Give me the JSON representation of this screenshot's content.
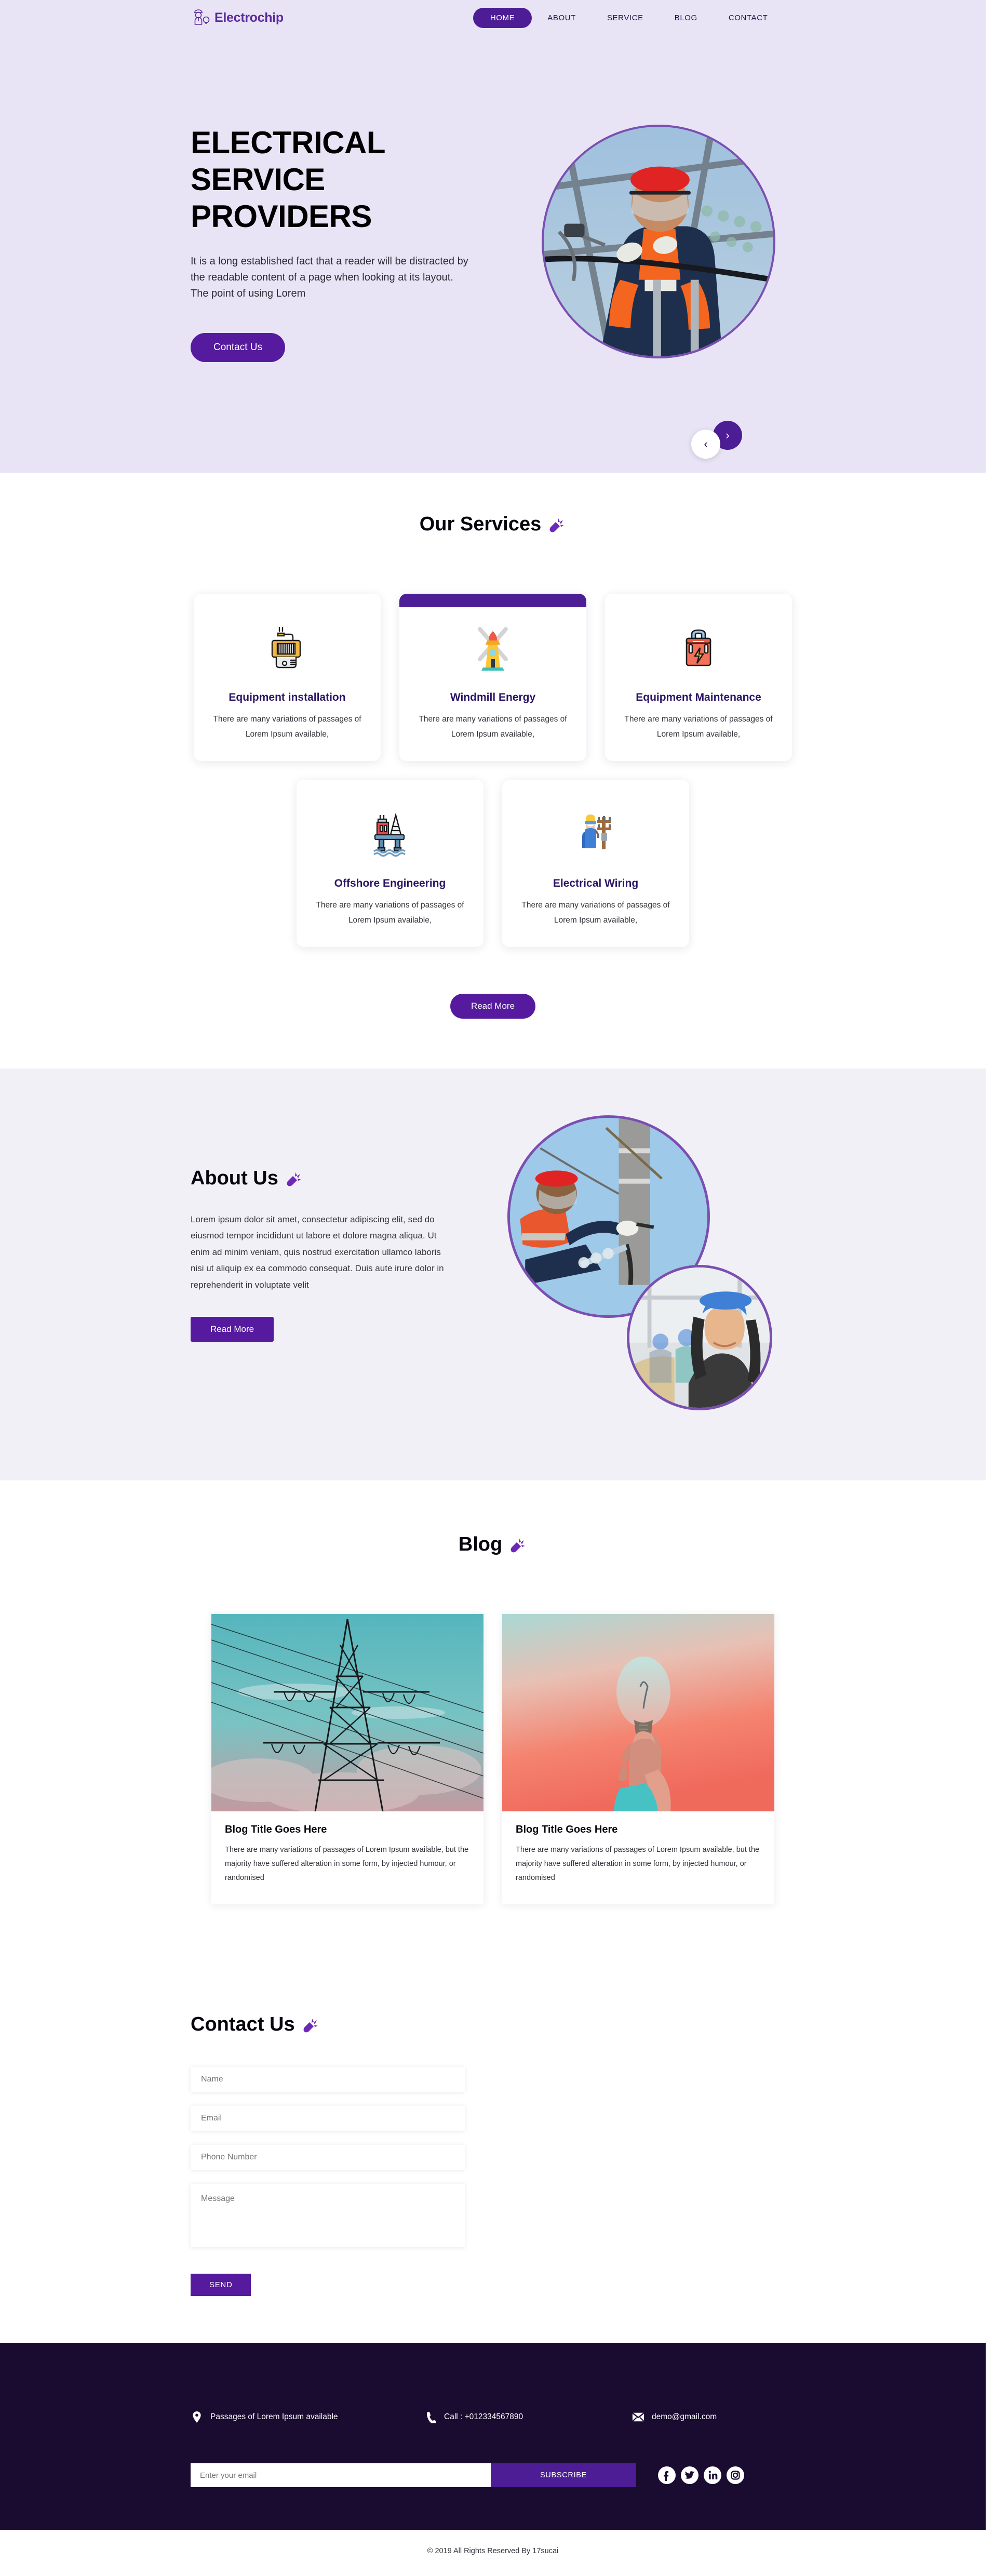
{
  "colors": {
    "primary": "#4c1d95",
    "primary_alt": "#551a9e",
    "hero_bg": "#e8e4f5",
    "about_bg": "#f2f0f7",
    "footer_bg": "#1a0b30",
    "heading_dark": "#07060e",
    "card_title": "#2b1464"
  },
  "header": {
    "brand_name": "Electrochip",
    "brand_icon": "electrician-logo-icon",
    "nav": [
      {
        "label": "HOME",
        "active": true
      },
      {
        "label": "ABOUT",
        "active": false
      },
      {
        "label": "SERVICE",
        "active": false
      },
      {
        "label": "BLOG",
        "active": false
      },
      {
        "label": "CONTACT",
        "active": false
      }
    ]
  },
  "hero": {
    "title": "ELECTRICAL SERVICE PROVIDERS",
    "description": "It is a long established fact that a reader will be distracted by the readable content of a page when looking at its layout. The point of using Lorem",
    "cta_label": "Contact Us",
    "image_alt": "lineman-working-on-power-line",
    "prev_label": "‹",
    "next_label": "›"
  },
  "services": {
    "heading": "Our Services",
    "heading_icon": "plug-icon",
    "row1": [
      {
        "title": "Equipment installation",
        "text": "There are many variations of passages of Lorem Ipsum available,",
        "icon": "transformer-icon",
        "featured": false
      },
      {
        "title": "Windmill Energy",
        "text": "There are many variations of passages of Lorem Ipsum available,",
        "icon": "windmill-icon",
        "featured": true
      },
      {
        "title": "Equipment Maintenance",
        "text": "There are many variations of passages of Lorem Ipsum available,",
        "icon": "toolbox-icon",
        "featured": false
      }
    ],
    "row2": [
      {
        "title": "Offshore Engineering",
        "text": "There are many variations of passages of Lorem Ipsum available,",
        "icon": "oil-rig-icon",
        "featured": false
      },
      {
        "title": "Electrical Wiring",
        "text": "There are many variations of passages of Lorem Ipsum available,",
        "icon": "electrician-pole-icon",
        "featured": false
      }
    ],
    "read_more_label": "Read More"
  },
  "about": {
    "heading": "About Us",
    "heading_icon": "plug-icon",
    "text": "Lorem ipsum dolor sit amet, consectetur adipiscing elit, sed do eiusmod tempor incididunt ut labore et dolore magna aliqua. Ut enim ad minim veniam, quis nostrud exercitation ullamco laboris nisi ut aliquip ex ea commodo consequat. Duis aute irure dolor in reprehenderit in voluptate velit",
    "read_more_label": "Read More",
    "image_big_alt": "worker-fixing-utility-pole",
    "image_small_alt": "engineer-in-blue-hardhat"
  },
  "blog": {
    "heading": "Blog",
    "heading_icon": "plug-icon",
    "posts": [
      {
        "title": "Blog Title Goes Here",
        "text": "There are many variations of passages of Lorem Ipsum available, but the majority have suffered alteration in some form, by injected humour, or randomised",
        "image_alt": "transmission-tower-at-dusk"
      },
      {
        "title": "Blog Title Goes Here",
        "text": "There are many variations of passages of Lorem Ipsum available, but the majority have suffered alteration in some form, by injected humour, or randomised",
        "image_alt": "hand-holding-lightbulb-sunset"
      }
    ]
  },
  "contact": {
    "heading": "Contact Us",
    "heading_icon": "plug-icon",
    "fields": {
      "name_placeholder": "Name",
      "email_placeholder": "Email",
      "phone_placeholder": "Phone Number",
      "message_placeholder": "Message"
    },
    "values": {
      "name": "",
      "email": "",
      "phone": "",
      "message": ""
    },
    "send_label": "SEND"
  },
  "footer": {
    "address": "Passages of Lorem Ipsum available",
    "phone": "Call : +012334567890",
    "email": "demo@gmail.com",
    "address_icon": "location-pin-icon",
    "phone_icon": "phone-icon",
    "email_icon": "envelope-icon",
    "newsletter_placeholder": "Enter your email",
    "newsletter_value": "",
    "subscribe_label": "SUBSCRIBE",
    "socials": [
      {
        "name": "facebook-icon",
        "glyph": "f"
      },
      {
        "name": "twitter-icon",
        "glyph": "t"
      },
      {
        "name": "linkedin-icon",
        "glyph": "in"
      },
      {
        "name": "instagram-icon",
        "glyph": "ig"
      }
    ],
    "copyright": "© 2019 All Rights Reserved By 17sucai"
  }
}
